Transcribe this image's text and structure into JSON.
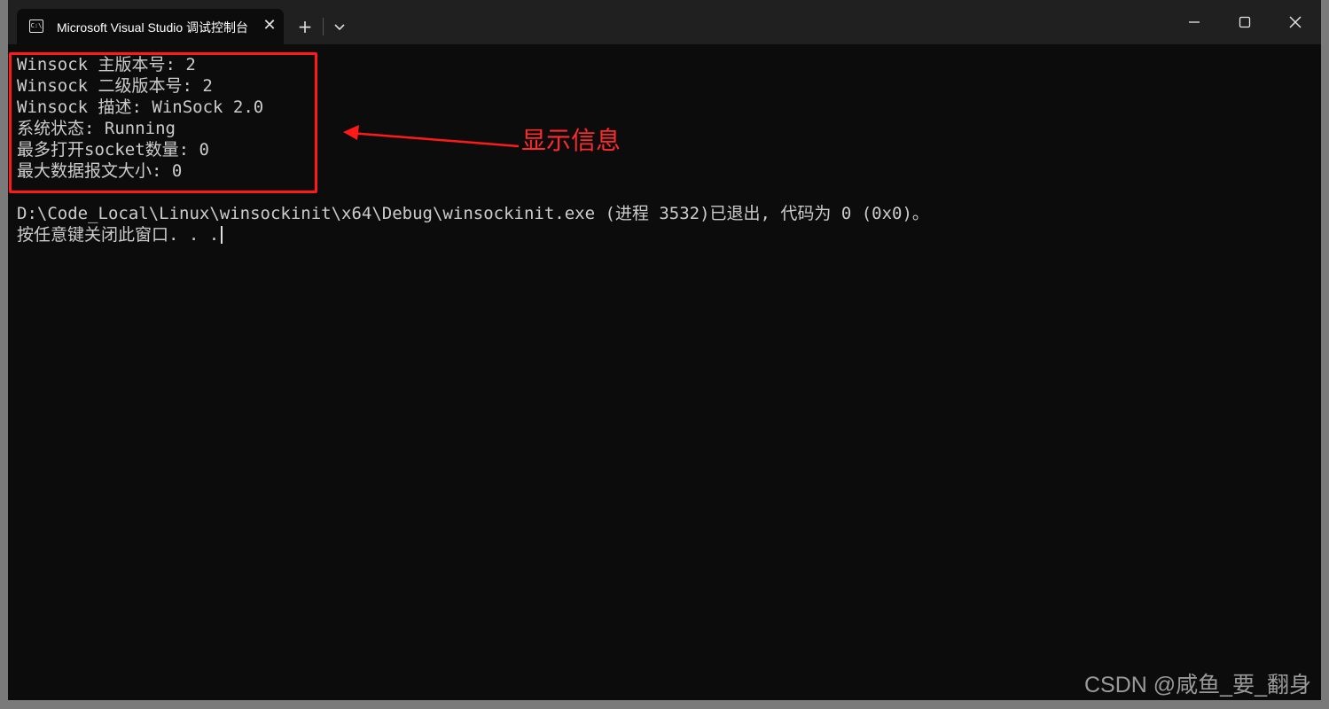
{
  "window": {
    "tab_title": "Microsoft Visual Studio 调试控制台",
    "tab_icon_glyph": "C:\\",
    "close_tab_glyph": "✕",
    "new_tab_glyph": "+",
    "icons": {
      "tab": "terminal-icon",
      "dropdown": "chevron-down-icon",
      "minimize": "minimize-icon",
      "maximize": "maximize-icon",
      "close": "close-icon"
    }
  },
  "console": {
    "lines": [
      "Winsock 主版本号: 2",
      "Winsock 二级版本号: 2",
      "Winsock 描述: WinSock 2.0",
      "系统状态: Running",
      "最多打开socket数量: 0",
      "最大数据报文大小: 0"
    ],
    "exit_line": "D:\\Code_Local\\Linux\\winsockinit\\x64\\Debug\\winsockinit.exe (进程 3532)已退出, 代码为 0 (0x0)。",
    "prompt_line": "按任意键关闭此窗口. . ."
  },
  "annotation": {
    "label": "显示信息",
    "color": "#ff1a1a"
  },
  "watermark": "CSDN @咸鱼_要_翻身",
  "colors": {
    "console_bg": "#0c0c0c",
    "titlebar_bg": "#202020",
    "text": "#cccccc"
  }
}
